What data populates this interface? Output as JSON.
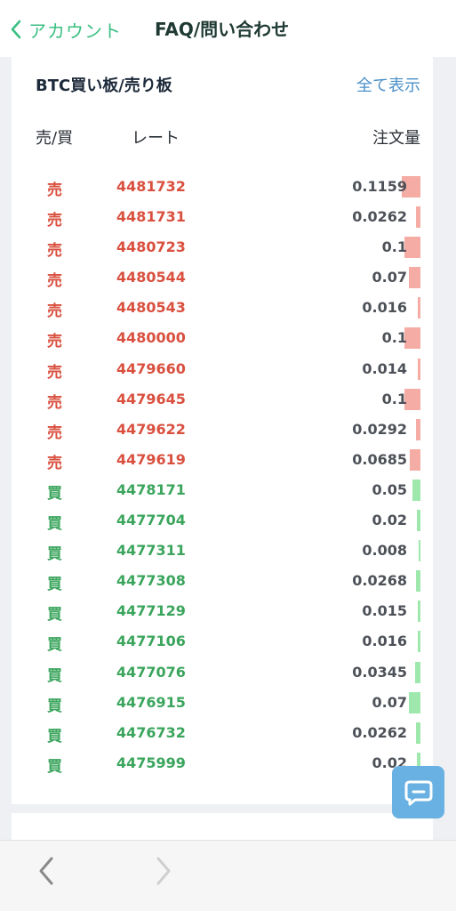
{
  "header": {
    "back_label": "アカウント",
    "faq_label": "FAQ/問い合わせ"
  },
  "orderbook": {
    "title": "BTC買い板/売り板",
    "show_all": "全て表示",
    "col_side": "売/買",
    "col_rate": "レート",
    "col_amount": "注文量",
    "colors": {
      "sell": "#d9503f",
      "buy": "#3ba55d"
    },
    "rows": [
      {
        "side": "売",
        "type": "sell",
        "rate": "4481732",
        "amount": "0.1159",
        "bar_fraction": 1.0
      },
      {
        "side": "売",
        "type": "sell",
        "rate": "4481731",
        "amount": "0.0262",
        "bar_fraction": 0.22
      },
      {
        "side": "売",
        "type": "sell",
        "rate": "4480723",
        "amount": "0.1",
        "bar_fraction": 0.86
      },
      {
        "side": "売",
        "type": "sell",
        "rate": "4480544",
        "amount": "0.07",
        "bar_fraction": 0.6
      },
      {
        "side": "売",
        "type": "sell",
        "rate": "4480543",
        "amount": "0.016",
        "bar_fraction": 0.14
      },
      {
        "side": "売",
        "type": "sell",
        "rate": "4480000",
        "amount": "0.1",
        "bar_fraction": 0.86
      },
      {
        "side": "売",
        "type": "sell",
        "rate": "4479660",
        "amount": "0.014",
        "bar_fraction": 0.12
      },
      {
        "side": "売",
        "type": "sell",
        "rate": "4479645",
        "amount": "0.1",
        "bar_fraction": 0.86
      },
      {
        "side": "売",
        "type": "sell",
        "rate": "4479622",
        "amount": "0.0292",
        "bar_fraction": 0.25
      },
      {
        "side": "売",
        "type": "sell",
        "rate": "4479619",
        "amount": "0.0685",
        "bar_fraction": 0.59
      },
      {
        "side": "買",
        "type": "buy",
        "rate": "4478171",
        "amount": "0.05",
        "bar_fraction": 0.43
      },
      {
        "side": "買",
        "type": "buy",
        "rate": "4477704",
        "amount": "0.02",
        "bar_fraction": 0.17
      },
      {
        "side": "買",
        "type": "buy",
        "rate": "4477311",
        "amount": "0.008",
        "bar_fraction": 0.07
      },
      {
        "side": "買",
        "type": "buy",
        "rate": "4477308",
        "amount": "0.0268",
        "bar_fraction": 0.23
      },
      {
        "side": "買",
        "type": "buy",
        "rate": "4477129",
        "amount": "0.015",
        "bar_fraction": 0.13
      },
      {
        "side": "買",
        "type": "buy",
        "rate": "4477106",
        "amount": "0.016",
        "bar_fraction": 0.14
      },
      {
        "side": "買",
        "type": "buy",
        "rate": "4477076",
        "amount": "0.0345",
        "bar_fraction": 0.3
      },
      {
        "side": "買",
        "type": "buy",
        "rate": "4476915",
        "amount": "0.07",
        "bar_fraction": 0.6
      },
      {
        "side": "買",
        "type": "buy",
        "rate": "4476732",
        "amount": "0.0262",
        "bar_fraction": 0.22
      },
      {
        "side": "買",
        "type": "buy",
        "rate": "4475999",
        "amount": "0.02",
        "bar_fraction": 0.17
      }
    ]
  },
  "chat": {
    "icon": "chat-bubble-icon"
  },
  "browser_nav": {
    "back_icon": "chevron-left-icon",
    "forward_icon": "chevron-right-icon"
  }
}
